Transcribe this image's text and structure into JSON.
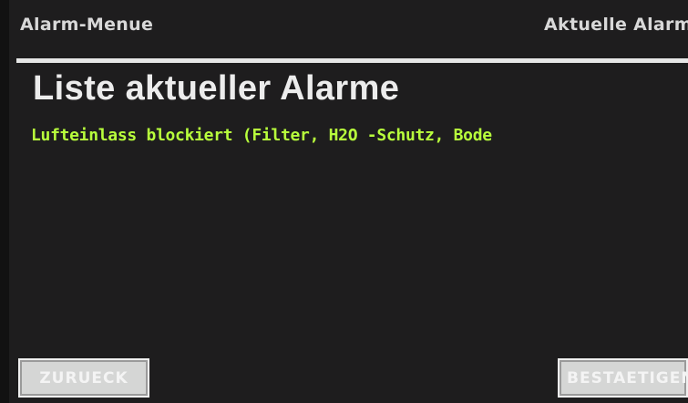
{
  "header": {
    "menu_title": "Alarm-Menue",
    "section_title": "Aktuelle Alarme"
  },
  "main": {
    "title": "Liste aktueller Alarme",
    "alarms": [
      "Lufteinlass blockiert (Filter, H2O -Schutz, Bode"
    ]
  },
  "buttons": {
    "back_label": "ZURUECK",
    "confirm_label": "BESTAETIGEN"
  },
  "colors": {
    "background": "#1e1d1e",
    "alarm_text": "#b8ff3c",
    "header_text": "#d8d8d8",
    "button_face": "#d5d6d5"
  }
}
